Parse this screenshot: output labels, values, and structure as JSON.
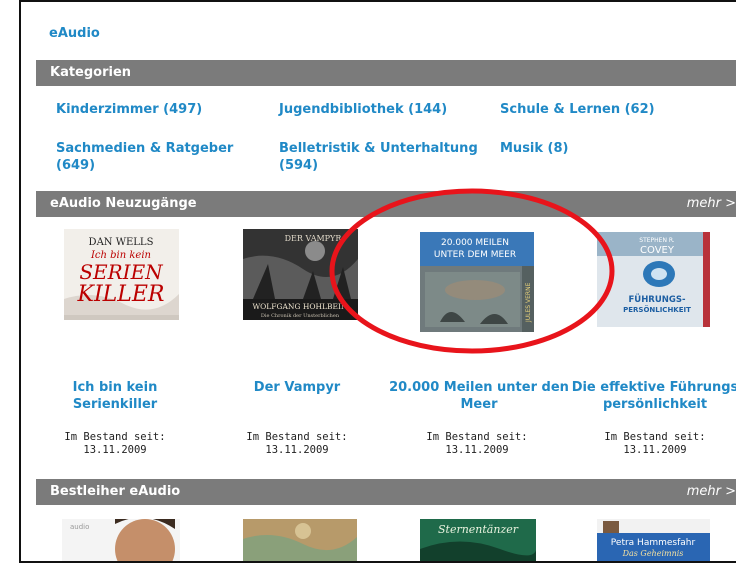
{
  "header": {
    "title": "eAudio"
  },
  "categories": {
    "title": "Kategorien",
    "items": [
      {
        "label": "Kinderzimmer (497)"
      },
      {
        "label": "Jugendbibliothek (144)"
      },
      {
        "label": "Schule & Lernen (62)"
      },
      {
        "label": "Sachmedien & Ratgeber (649)"
      },
      {
        "label": "Belletristik & Unterhaltung (594)"
      },
      {
        "label": "Musik (8)"
      }
    ]
  },
  "new_items": {
    "title": "eAudio Neuzugänge",
    "more": "mehr >",
    "books": [
      {
        "title": "Ich bin kein Serienkiller",
        "stock_label": "Im Bestand seit:",
        "date": "13.11.2009",
        "cover_text_1": "DAN WELLS",
        "cover_text_2": "Ich bin kein",
        "cover_text_3": "SERIEN",
        "cover_text_4": "KILLER"
      },
      {
        "title": "Der Vampyr",
        "stock_label": "Im Bestand seit:",
        "date": "13.11.2009",
        "cover_text_1": "DER VAMPYR",
        "cover_text_2": "WOLFGANG HOHLBEIN",
        "cover_text_3": "Die Chronik der Unsterblichen"
      },
      {
        "title": "20.000 Meilen unter den Meer",
        "stock_label": "Im Bestand seit:",
        "date": "13.11.2009",
        "cover_text_1": "20.000 MEILEN",
        "cover_text_2": "UNTER DEM MEER",
        "cover_text_3": "JULES VERNE"
      },
      {
        "title": "Die effektive Führungspersönlichkeit",
        "stock_label": "Im Bestand seit:",
        "date": "13.11.2009",
        "cover_text_1": "STEPHEN R.",
        "cover_text_2": "COVEY",
        "cover_text_3": "FÜHRUNGS-",
        "cover_text_4": "PERSÖNLICHKEIT"
      }
    ]
  },
  "top_borrowers": {
    "title": "Bestleiher eAudio",
    "more": "mehr >",
    "covers": [
      {
        "text": "audio"
      },
      {
        "text": ""
      },
      {
        "text": "Sternentänzer"
      },
      {
        "text_1": "Petra Hammesfahr",
        "text_2": "Das Geheimnis"
      }
    ]
  },
  "annotation": {
    "color": "#e8141b"
  },
  "colors": {
    "link": "#2089c6",
    "section_bar": "#7b7b7b"
  }
}
